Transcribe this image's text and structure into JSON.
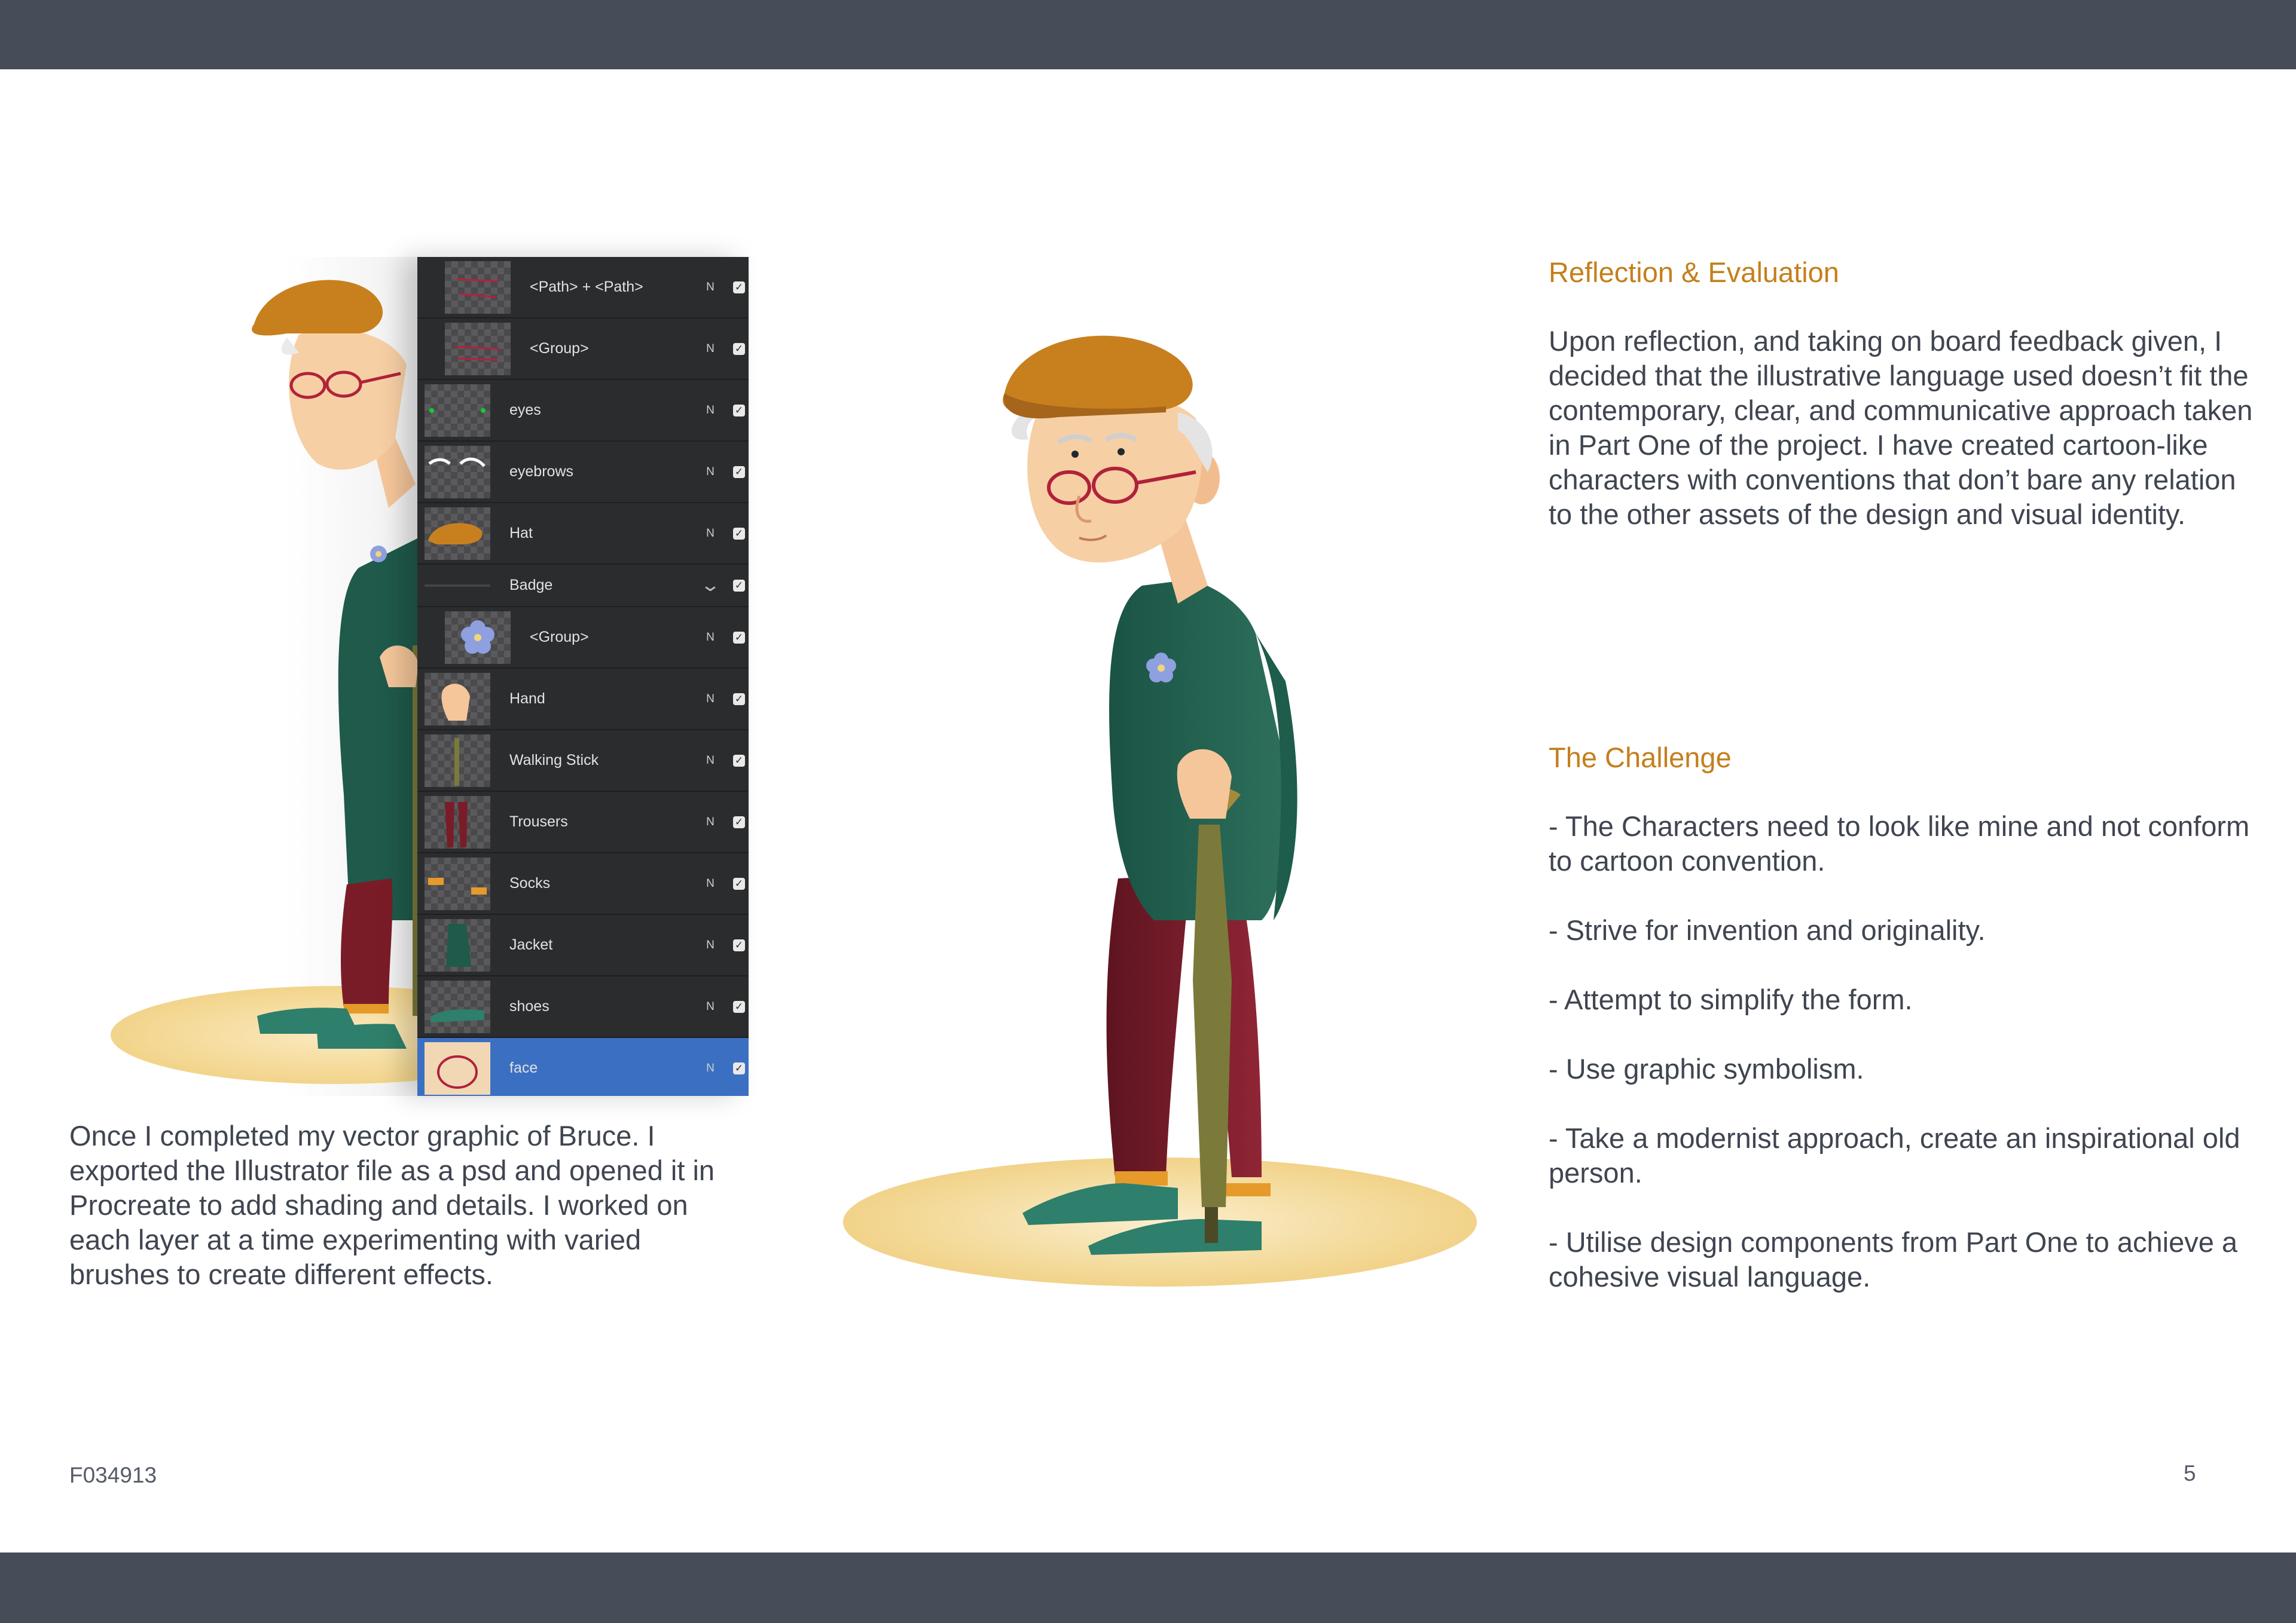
{
  "layers_panel": {
    "layers": [
      {
        "label": "<Path> + <Path>",
        "blend": "N",
        "kind": "sub",
        "thumb": "path-thumb"
      },
      {
        "label": "<Group>",
        "blend": "N",
        "kind": "sub",
        "thumb": "group-thumb"
      },
      {
        "label": "eyes",
        "blend": "N",
        "kind": "layer",
        "thumb": "eyes-thumb"
      },
      {
        "label": "eyebrows",
        "blend": "N",
        "kind": "layer",
        "thumb": "eyebrows-thumb"
      },
      {
        "label": "Hat",
        "blend": "N",
        "kind": "layer",
        "thumb": "hat-thumb"
      },
      {
        "label": "Badge",
        "blend": "",
        "kind": "group",
        "thumb": ""
      },
      {
        "label": "<Group>",
        "blend": "N",
        "kind": "sub",
        "thumb": "flower-thumb"
      },
      {
        "label": "Hand",
        "blend": "N",
        "kind": "layer",
        "thumb": "hand-thumb"
      },
      {
        "label": "Walking Stick",
        "blend": "N",
        "kind": "layer",
        "thumb": "stick-thumb"
      },
      {
        "label": "Trousers",
        "blend": "N",
        "kind": "layer",
        "thumb": "trousers-thumb"
      },
      {
        "label": "Socks",
        "blend": "N",
        "kind": "layer",
        "thumb": "socks-thumb"
      },
      {
        "label": "Jacket",
        "blend": "N",
        "kind": "layer",
        "thumb": "jacket-thumb"
      },
      {
        "label": "shoes",
        "blend": "N",
        "kind": "layer",
        "thumb": "shoes-thumb"
      },
      {
        "label": "face",
        "blend": "N",
        "kind": "layer",
        "thumb": "face-thumb",
        "selected": true
      }
    ]
  },
  "caption": "Once I completed my vector graphic of Bruce. I exported the Illustrator file as a psd and opened it in Procreate to add shading and details. I worked on each layer at a time experimenting with varied brushes to create different effects.",
  "reflection": {
    "heading": "Reflection & Evaluation",
    "body": "Upon reflection, and taking on board feedback given, I decided that the illustrative language used doesn’t fit the contemporary, clear, and communicative approach taken in Part One of the project. I have created cartoon-like characters with conventions that don’t bare any relation to the other assets of the design and visual identity."
  },
  "challenge": {
    "heading": "The Challenge",
    "items": [
      "- The Characters need to look like mine and not conform to cartoon convention.",
      "- Strive for invention and originality.",
      "- Attempt to simplify the form.",
      "- Use graphic symbolism.",
      "- Take a modernist approach, create an inspirational old person.",
      "- Utilise design components from Part One to achieve a cohesive visual language."
    ]
  },
  "footer": {
    "doc_id": "F034913",
    "page_number": "5"
  },
  "colors": {
    "band": "#464d59",
    "heading": "#c47f1c",
    "text": "#3f4550",
    "panel_bg": "#2b2c2e",
    "selected_layer": "#3b6fc2",
    "hat": "#c8801f",
    "jacket": "#1f5a4b",
    "trousers": "#7a1c28",
    "shoes": "#2e7f6b",
    "stick": "#7c7a3a",
    "ground": "#f6dfa0"
  }
}
